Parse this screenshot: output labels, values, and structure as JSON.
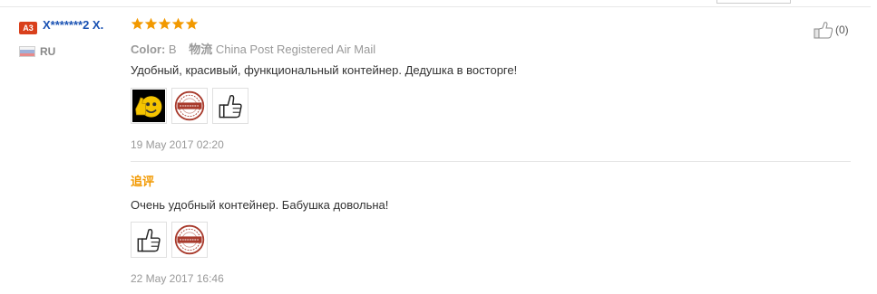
{
  "buyer": {
    "badge": "A3",
    "name": "X*******2 X.",
    "country": "RU"
  },
  "rating": {
    "stars": 5,
    "max": 5
  },
  "order_info": {
    "color_label": "Color:",
    "color_value": "B",
    "shipping_label": "物流",
    "shipping_value": "China Post Registered Air Mail"
  },
  "review": {
    "text": "Удобный, красивый, функциональный контейнер. Дедушка в восторге!",
    "photos": [
      "smiley-thumbs-up",
      "recommended-stamp",
      "thumbs-up-outline"
    ],
    "date": "19 May 2017 02:20"
  },
  "followup": {
    "label": "追评",
    "text": "Очень удобный контейнер. Бабушка довольна!",
    "photos": [
      "thumbs-up-outline",
      "recommended-stamp"
    ],
    "date": "22 May 2017 16:46"
  },
  "helpful": {
    "count": "(0)"
  },
  "colors": {
    "name_blue": "#1a52b3",
    "star_orange": "#f29900",
    "badge_red": "#d9401c"
  }
}
